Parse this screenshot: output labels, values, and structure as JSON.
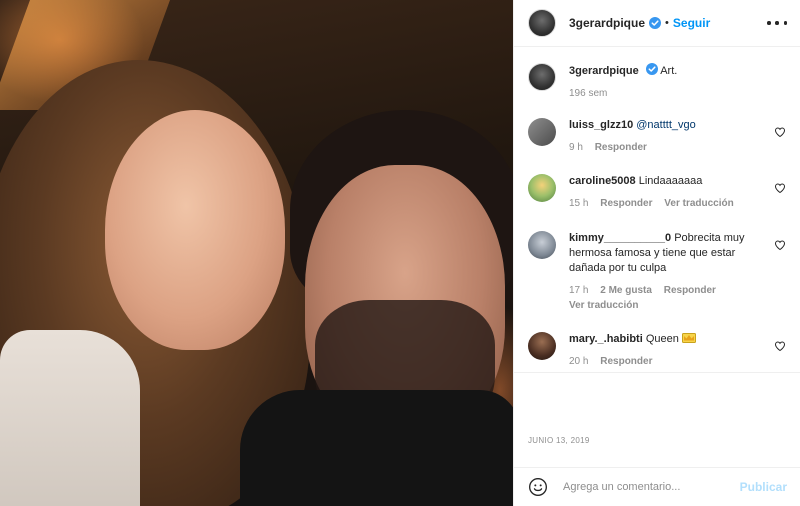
{
  "post": {
    "author": "3gerardpique",
    "separator": "•",
    "follow_label": "Seguir",
    "caption": {
      "username": "3gerardpique",
      "text": "Art.",
      "time": "196 sem"
    },
    "date": "JUNIO 13, 2019"
  },
  "comments": [
    {
      "username": "luiss_glzz10",
      "text": "@natttt_vgo",
      "time": "9 h",
      "actions": [
        "Responder"
      ]
    },
    {
      "username": "caroline5008",
      "text": "Lindaaaaaaa",
      "time": "15 h",
      "actions": [
        "Responder",
        "Ver traducción"
      ]
    },
    {
      "username": "kimmy__________0",
      "text": "Pobrecita muy hermosa famosa y tiene que estar dañada por tu culpa",
      "time": "17 h",
      "actions": [
        "2 Me gusta",
        "Responder",
        "Ver traducción"
      ]
    },
    {
      "username": "mary._.habibti",
      "text": "Queen",
      "time": "20 h",
      "actions": [
        "Responder"
      ],
      "emoji": "crown-icon"
    }
  ],
  "composer": {
    "placeholder": "Agrega un comentario...",
    "post_label": "Publicar"
  },
  "colors": {
    "accent": "#0095f6",
    "text": "#262626",
    "muted": "#8e8e8e",
    "verified": "#3897f0"
  }
}
